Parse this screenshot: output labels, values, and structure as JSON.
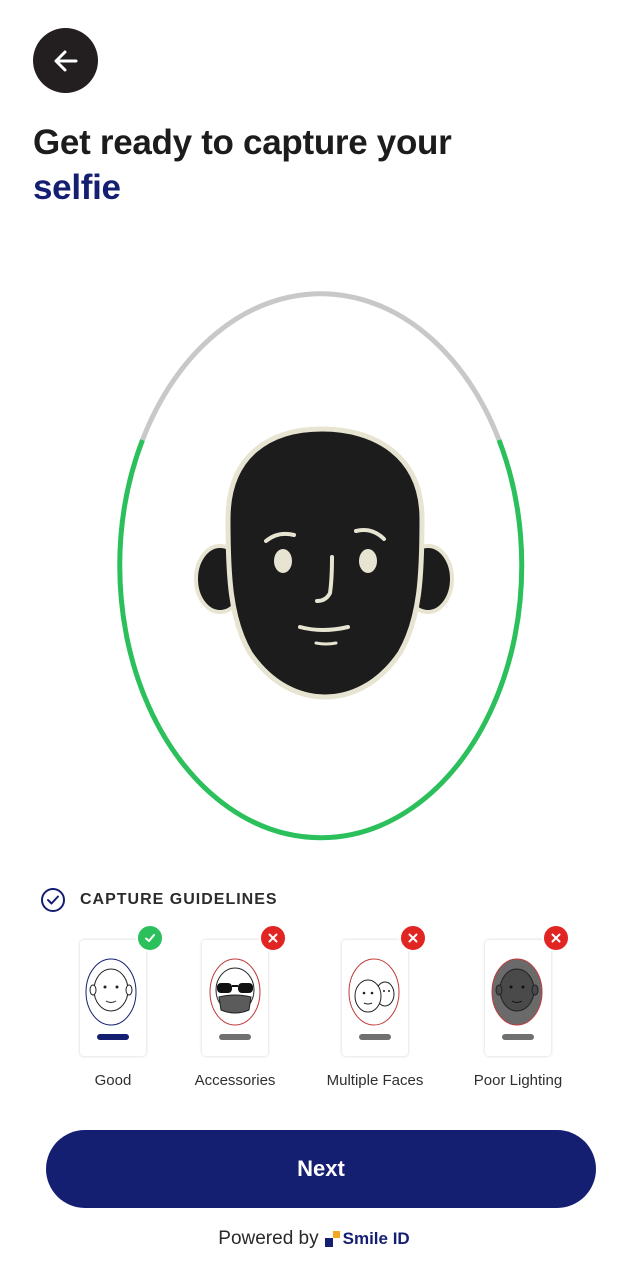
{
  "header": {
    "back_icon": "arrow-left-icon"
  },
  "title": {
    "line1": "Get ready to capture your",
    "line2": "selfie"
  },
  "guidelines": {
    "heading": "CAPTURE GUIDELINES",
    "items": [
      {
        "label": "Good",
        "status": "check"
      },
      {
        "label": "Accessories",
        "status": "cross"
      },
      {
        "label": "Multiple Faces",
        "status": "cross"
      },
      {
        "label": "Poor Lighting",
        "status": "cross"
      }
    ]
  },
  "actions": {
    "next_label": "Next"
  },
  "footer": {
    "powered_by": "Powered by",
    "brand": "Smile ID"
  },
  "colors": {
    "primary": "#151f72",
    "success": "#2cc05c",
    "error": "#e02523",
    "ring_gray": "#c8c8c8"
  }
}
